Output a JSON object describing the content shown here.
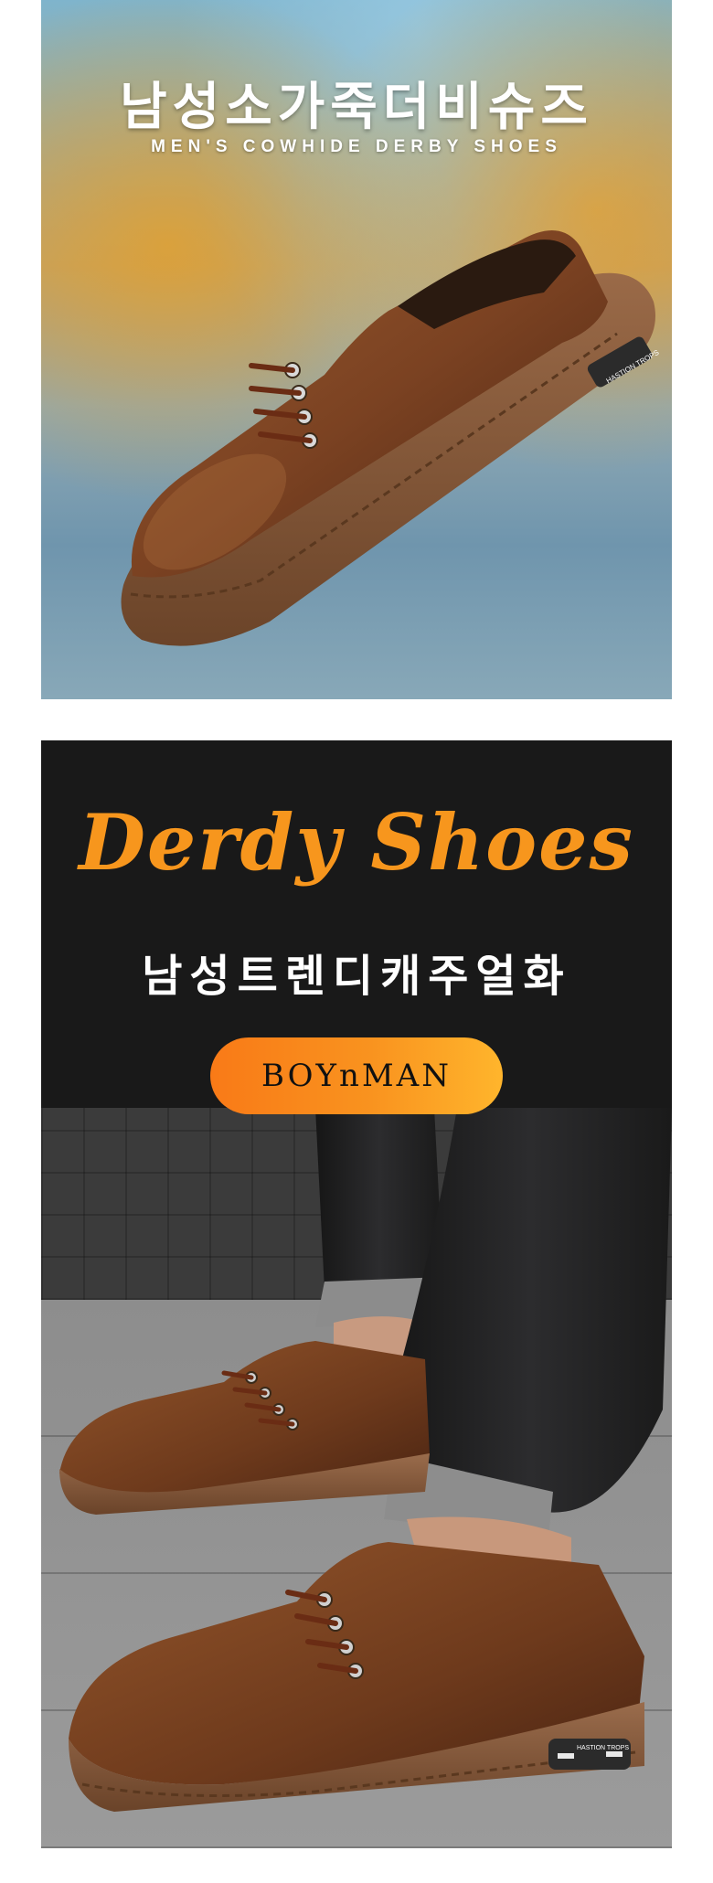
{
  "banner1": {
    "title_ko": "남성소가죽더비슈즈",
    "title_en": "MEN'S COWHIDE DERBY SHOES",
    "shoe_logo_text": "HASTION TROPS"
  },
  "banner2": {
    "title": "Derdy Shoes",
    "subtitle_ko": "남성트렌디캐주얼화",
    "brand": "BOYnMAN",
    "shoe_logo_text": "HASTION TROPS"
  },
  "colors": {
    "accent_orange": "#f7961d",
    "dark_bg": "#191919",
    "leather_brown": "#7a4222",
    "sole_brown": "#8a5a3c"
  }
}
